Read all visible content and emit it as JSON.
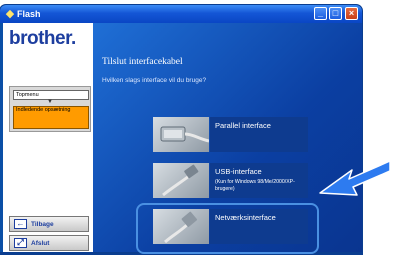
{
  "window": {
    "title": "Flash",
    "buttons": {
      "minimize": "_",
      "maximize": "□",
      "close": "×"
    }
  },
  "sidebar": {
    "logo": "brother",
    "menu": {
      "top_item": "Topmenu",
      "arrow": "▼",
      "active_item": "Indledende opsætning"
    },
    "back_label": "Tilbage",
    "exit_label": "Afslut"
  },
  "main": {
    "title": "Tilslut interfacekabel",
    "question": "Hvilken slags interface vil du bruge?",
    "options": [
      {
        "title": "Parallel interface",
        "subtitle": ""
      },
      {
        "title": "USB-interface",
        "subtitle": "(Kun for Windows 98/Me/2000/XP-brugere)"
      },
      {
        "title": "Netværksinterface",
        "subtitle": ""
      }
    ]
  },
  "colors": {
    "brand": "#1d3e9f",
    "highlight": "#4a90e2",
    "active_menu": "#ff9b00",
    "panel": "#0b4fa6"
  }
}
